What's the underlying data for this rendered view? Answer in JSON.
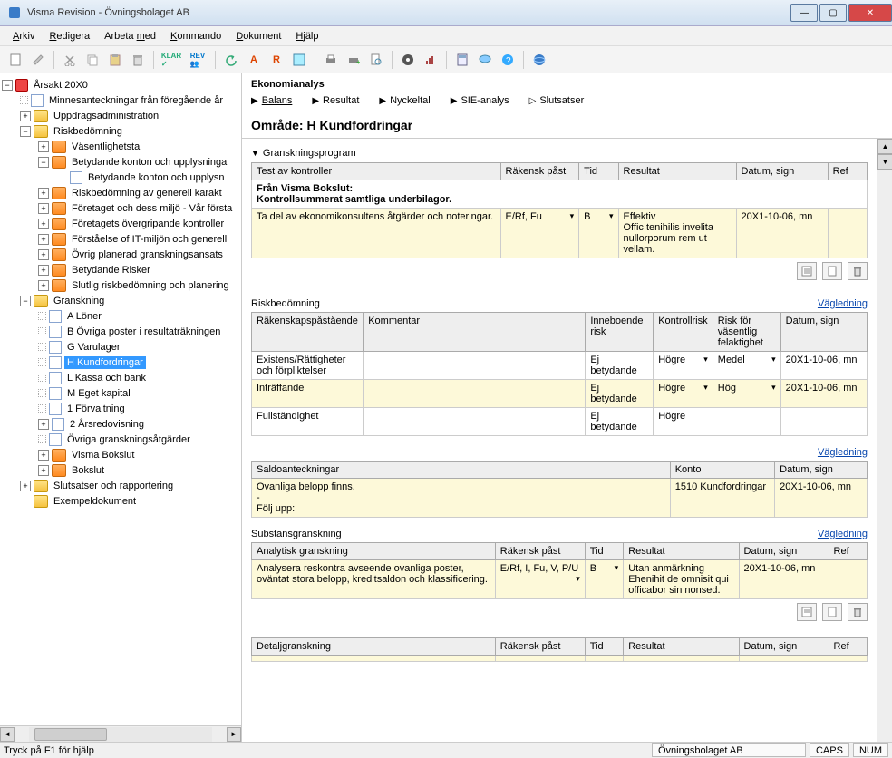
{
  "titlebar": {
    "title": "Visma Revision - Övningsbolaget AB"
  },
  "menu": {
    "arkiv": "Arkiv",
    "redigera": "Redigera",
    "arbeta_med": "Arbeta med",
    "kommando": "Kommando",
    "dokument": "Dokument",
    "hjalp": "Hjälp"
  },
  "tree": {
    "root": "Årsakt 20X0",
    "items": [
      "Minnesanteckningar från föregående år",
      "Uppdragsadministration",
      "Riskbedömning",
      "Väsentlighetstal",
      "Betydande konton och upplysninga",
      "Betydande konton och upplysn",
      "Riskbedömning av generell karakt",
      "Företaget och dess miljö - Vår första",
      "Företagets övergripande kontroller",
      "Förståelse of IT-miljön och generell",
      "Övrig planerad granskningsansats",
      "Betydande Risker",
      "Slutlig riskbedömning och planering",
      "Granskning",
      "A Löner",
      "B Övriga poster i resultaträkningen",
      "G Varulager",
      "H Kundfordringar",
      "L Kassa och bank",
      "M Eget kapital",
      "1 Förvaltning",
      "2 Årsredovisning",
      "Övriga granskningsåtgärder",
      "Visma Bokslut",
      "Bokslut",
      "Slutsatser och rapportering",
      "Exempeldokument"
    ]
  },
  "content": {
    "header": "Ekonomianalys",
    "tabs": {
      "balans": "Balans",
      "resultat": "Resultat",
      "nyckeltal": "Nyckeltal",
      "sie": "SIE-analys",
      "slutsatser": "Slutsatser"
    },
    "area_title": "Område: H Kundfordringar",
    "program_heading": "Granskningsprogram",
    "vagledning": "Vägledning"
  },
  "test_table": {
    "headers": {
      "c1": "Test av kontroller",
      "c2": "Räkensk påst",
      "c3": "Tid",
      "c4": "Resultat",
      "c5": "Datum, sign",
      "c6": "Ref"
    },
    "row_bold_1": "Från Visma Bokslut:",
    "row_bold_2": "Kontrollsummerat samtliga underbilagor.",
    "row2_c1": "Ta del av ekonomikonsultens åtgärder och noteringar.",
    "row2_c2": "E/Rf, Fu",
    "row2_c3": "B",
    "row2_c4": "Effektiv\nOffic tenihilis invelita nullorporum rem ut vellam.",
    "row2_c5": "20X1-10-06, mn"
  },
  "risk_table": {
    "title": "Riskbedömning",
    "headers": {
      "c1": "Räkenskapspåstående",
      "c2": "Kommentar",
      "c3": "Inneboende risk",
      "c4": "Kontrollrisk",
      "c5": "Risk för väsentlig felaktighet",
      "c6": "Datum, sign"
    },
    "rows": [
      {
        "c1": "Existens/Rättigheter och förpliktelser",
        "c2": "",
        "c3": "Ej betydande",
        "c4": "Högre",
        "c5": "Medel",
        "c6": "20X1-10-06, mn"
      },
      {
        "c1": "Inträffande",
        "c2": "",
        "c3": "Ej betydande",
        "c4": "Högre",
        "c5": "Hög",
        "c6": "20X1-10-06, mn"
      },
      {
        "c1": "Fullständighet",
        "c2": "",
        "c3": "Ej betydande",
        "c4": "Högre",
        "c5": "",
        "c6": ""
      }
    ]
  },
  "saldo_table": {
    "headers": {
      "c1": "Saldoanteckningar",
      "c2": "Konto",
      "c3": "Datum, sign"
    },
    "row": {
      "c1": "Ovanliga belopp finns.\n-\nFölj upp:",
      "c2": "1510 Kundfordringar",
      "c3": "20X1-10-06, mn"
    }
  },
  "subst_section": {
    "title": "Substansgranskning"
  },
  "analytisk_table": {
    "headers": {
      "c1": "Analytisk granskning",
      "c2": "Räkensk påst",
      "c3": "Tid",
      "c4": "Resultat",
      "c5": "Datum, sign",
      "c6": "Ref"
    },
    "row": {
      "c1": "Analysera reskontra avseende ovanliga poster, oväntat stora belopp, kreditsaldon och klassificering.",
      "c2": "E/Rf, I, Fu, V, P/U",
      "c3": "B",
      "c4": "Utan anmärkning\nEhenihit de omnisit qui officabor sin nonsed.",
      "c5": "20X1-10-06, mn"
    }
  },
  "detalj_table": {
    "headers": {
      "c1": "Detaljgranskning",
      "c2": "Räkensk påst",
      "c3": "Tid",
      "c4": "Resultat",
      "c5": "Datum, sign",
      "c6": "Ref"
    }
  },
  "statusbar": {
    "help": "Tryck på F1 för hjälp",
    "company": "Övningsbolaget AB",
    "caps": "CAPS",
    "num": "NUM"
  }
}
